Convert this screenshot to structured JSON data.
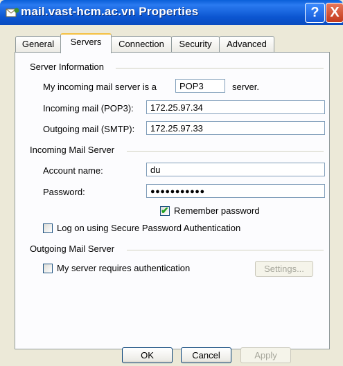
{
  "window": {
    "title": "mail.vast-hcm.ac.vn Properties",
    "help_label": "?",
    "close_label": "X"
  },
  "tabs": [
    {
      "label": "General"
    },
    {
      "label": "Servers"
    },
    {
      "label": "Connection"
    },
    {
      "label": "Security"
    },
    {
      "label": "Advanced"
    }
  ],
  "active_tab": "Servers",
  "server_info": {
    "group_label": "Server Information",
    "incoming_prefix": "My incoming mail server is a",
    "incoming_type": "POP3",
    "incoming_suffix": "server.",
    "incoming_label": "Incoming mail (POP3):",
    "incoming_value": "172.25.97.34",
    "outgoing_label": "Outgoing mail (SMTP):",
    "outgoing_value": "172.25.97.33"
  },
  "incoming_server": {
    "group_label": "Incoming Mail Server",
    "account_label": "Account name:",
    "account_value": "du",
    "password_label": "Password:",
    "password_value": "●●●●●●●●●●●",
    "remember_label": "Remember password",
    "remember_checked": true,
    "spa_label": "Log on using Secure Password Authentication",
    "spa_checked": false
  },
  "outgoing_server": {
    "group_label": "Outgoing Mail Server",
    "auth_label": "My server requires authentication",
    "auth_checked": false,
    "settings_label": "Settings..."
  },
  "buttons": {
    "ok": "OK",
    "cancel": "Cancel",
    "apply": "Apply"
  }
}
